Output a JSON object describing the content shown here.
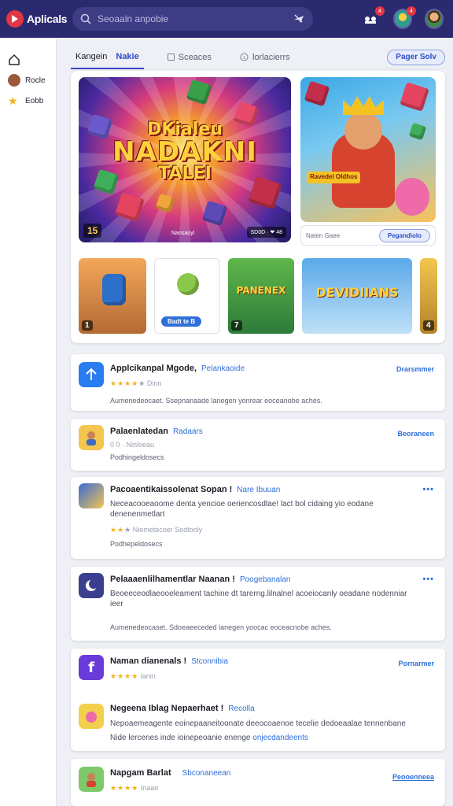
{
  "header": {
    "brand": "Aplicals",
    "search_placeholder": "Seoaaln anpobie",
    "badge_counts": [
      "4",
      "4"
    ],
    "icons": [
      "pets-notify-icon",
      "game-avatar-icon",
      "user-avatar"
    ]
  },
  "sidebar": {
    "items": [
      {
        "icon": "home-icon",
        "label": ""
      },
      {
        "icon": "profile-dot-icon",
        "label": "Rocle"
      },
      {
        "icon": "star-icon",
        "label": "Eobb"
      }
    ]
  },
  "tabs": {
    "items": [
      {
        "label": "Kangein",
        "sub": "Nakie",
        "active": true
      },
      {
        "label": "Sceaces",
        "active": false
      },
      {
        "label": "lorlacierrs",
        "active": false
      }
    ],
    "action_label": "Pager Solv"
  },
  "featured": {
    "hero_title": [
      "DKialeu",
      "NADAKNI",
      "TALEI"
    ],
    "hero_rating": "15",
    "hero_caption": "Nansaoyl",
    "hero_meta": "SD0D · ❤ 48",
    "side_sign": "Ravedel Oldhos",
    "side_caption": "Naten Gaee",
    "side_button": "Pegandiolo",
    "thumbs": [
      {
        "label": "1"
      },
      {
        "badge": "Badt te B"
      },
      {
        "word": "PANENEX",
        "label": "7"
      },
      {
        "word": "DEVIDIIANS"
      },
      {
        "label": "4"
      }
    ]
  },
  "apps": [
    {
      "title": "Applcikanpal Mgode,",
      "tag": "Pelankaoide",
      "stars_filled": "★★★★",
      "stars_empty": "★",
      "stars_text": "Dinn",
      "desc": "Aumenedeocaet. Ssepnanaade lanegen yonrear eoceanobe aches.",
      "action": "Drarsmmer",
      "icon": "share-plane-icon",
      "icon_color": "#2a7df0"
    },
    {
      "title": "Palaenlatedan",
      "tag": "Radaars",
      "stars_text": "0 0 · Ninloeau",
      "desc": "Podhingeldosecs",
      "action": "Beoraneen",
      "icon": "character-icon",
      "icon_color": "#f2c64f"
    },
    {
      "title": "Pacoaentikaissolenat Sopan !",
      "tag": "Nare Ibuuan",
      "desc_long": "Neceacooeaoome denta yencioe oeriencosdlae! lact bol cidaing yio eodane denenenmetlart",
      "stars_filled": "★★",
      "stars_empty": "★",
      "stars_text": "Niemetecoer Sedtooly",
      "desc": "Podhepeldosecs",
      "action": "•••",
      "icon": "game-collage-icon",
      "icon_color": "#3a6bd8"
    },
    {
      "title": "Pelaaaenlilhamentlar Naanan !",
      "tag": "Poogebanalan",
      "desc_long": "Beoeeceodlaeooeleament tachine dt tarerng.lilnalnel acoeiocanly oeadane nodenniar ieer",
      "desc": "Aumenedeocaset. Sdoeaeeceded lanegen yoocac eoceacnobe aches.",
      "action": "•••",
      "icon": "moon-icon",
      "icon_color": "#3b3f8f"
    },
    {
      "title": "Naman dianenals !",
      "tag": "Stconnibia",
      "stars_filled": "★★★★",
      "stars_empty": "",
      "stars_text": "lanin",
      "action": "Pornarmer",
      "icon": "facebook-icon",
      "icon_color": "#6a3bd8",
      "sub_title": "Negeena Iblag Nepaerhaet !",
      "sub_tag": "Recolla",
      "sub_desc": "Nepoaemeagente eoinepaaneitoonate deeocoaenoe tecelie dedoeaalae tennenbane",
      "sub_desc_2": "Nide lercenes inde ioinepeoanie enenge",
      "sub_desc_2_link": "onjecdandeents",
      "sub_icon": "pet-icon",
      "sub_icon_color": "#f3d04c"
    },
    {
      "title": "Napgam Barlat",
      "tag": "Sbconaneean",
      "stars_filled": "★★★★",
      "stars_empty": "",
      "stars_text": "Inaao",
      "action": "Peooenneea",
      "icon": "hero-icon",
      "icon_color": "#7ec96a"
    }
  ]
}
